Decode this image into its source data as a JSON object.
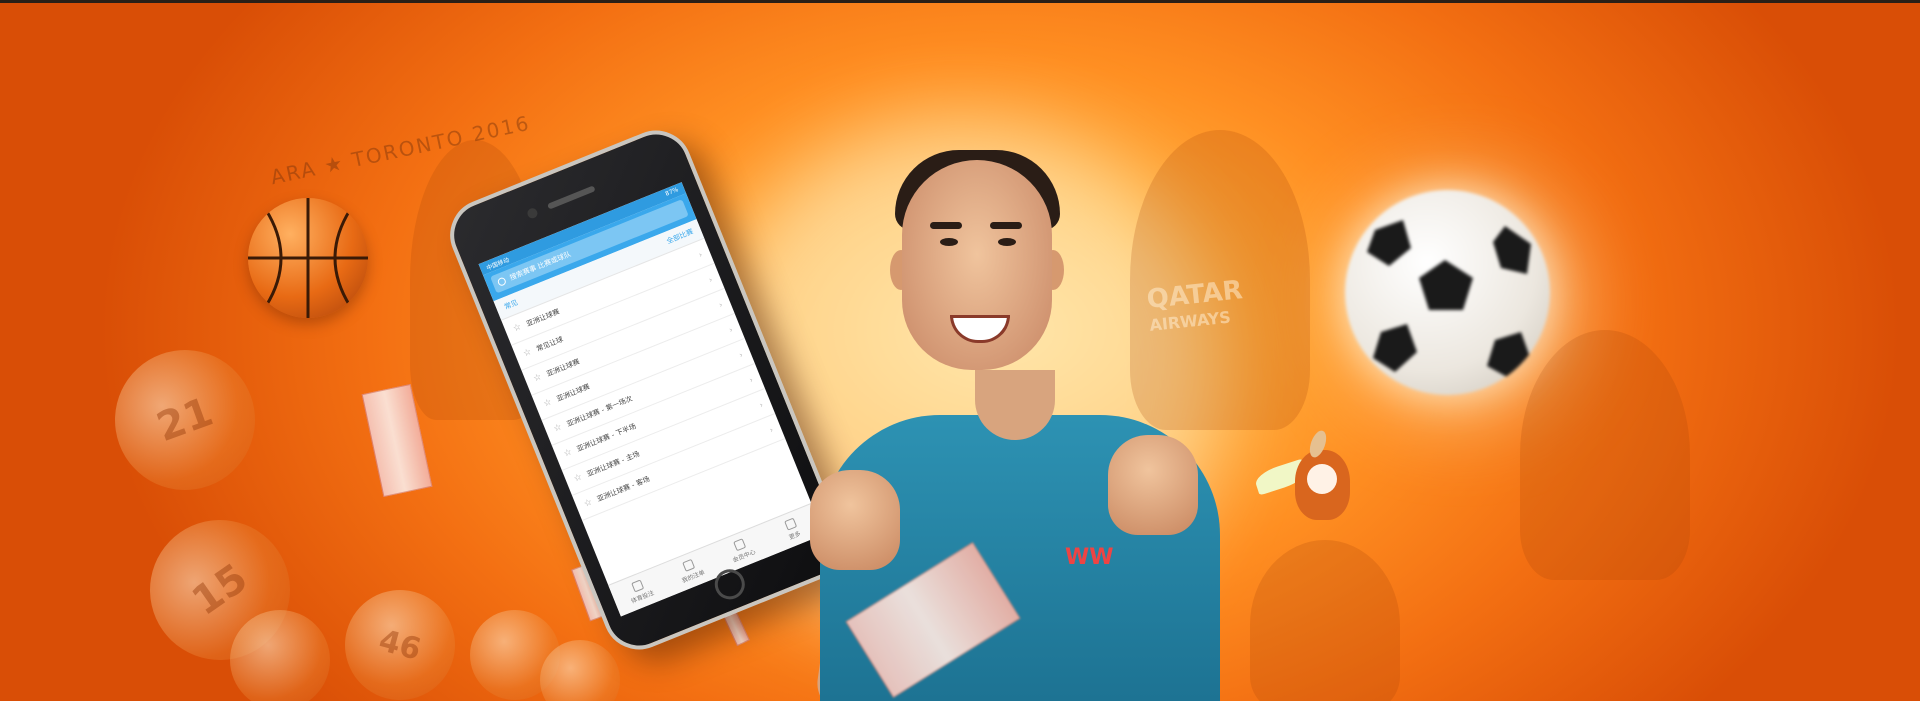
{
  "banner": {
    "bg_text": "ARA ★ TORONTO 2016",
    "jersey_line1": "QATAR",
    "jersey_line2": "AIRWAYS",
    "shirt_logo": "WW",
    "bingo_numbers": [
      "21",
      "15",
      "46"
    ]
  },
  "phone": {
    "status_left": "中国移动",
    "status_right": "87%",
    "search_placeholder": "搜索赛事 比赛或球队",
    "tabs": [
      "常见",
      "全部比赛"
    ],
    "menu_items": [
      {
        "label": "亚洲让球赛"
      },
      {
        "label": "常见让球"
      },
      {
        "label": "亚洲让球赛"
      },
      {
        "label": "亚洲让球赛"
      },
      {
        "label": "亚洲让球赛 - 第一场次"
      },
      {
        "label": "亚洲让球赛 - 下半场"
      },
      {
        "label": "亚洲让球赛 - 主场"
      },
      {
        "label": "亚洲让球赛 - 客场"
      }
    ],
    "bottom_nav": [
      "体育投注",
      "我的注单",
      "会员中心",
      "更多"
    ]
  },
  "colors": {
    "accent": "#3aa8ec",
    "shirt": "#2d92b3",
    "background": "#f36f12"
  }
}
